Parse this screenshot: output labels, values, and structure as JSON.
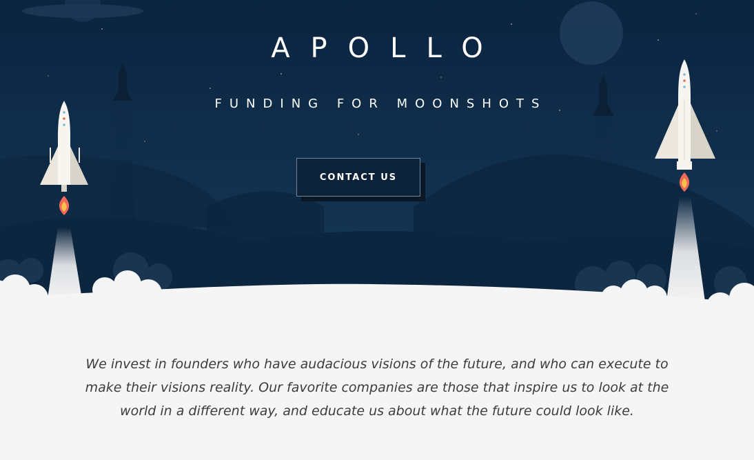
{
  "hero": {
    "brand": "APOLLO",
    "tagline": "FUNDING FOR MOONSHOTS",
    "cta_label": "CONTACT US"
  },
  "intro": {
    "text": "We invest in founders who have audacious visions of the future, and who can execute to make their visions reality. Our favorite companies are those that inspire us to look at the world in a different way, and educate us about what the future could look like."
  },
  "colors": {
    "sky": "#0f2d4a",
    "mountains": "#0d2640",
    "foreground": "#f5f5f5",
    "flame_outer": "#f06a5a",
    "flame_inner": "#f7c04a"
  },
  "icons": [
    "rocket-icon",
    "flame-icon",
    "planet-icon",
    "moon-icon"
  ]
}
